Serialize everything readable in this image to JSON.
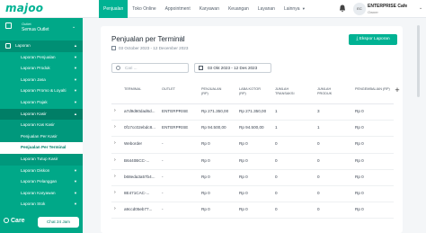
{
  "app": {
    "logo": "majoo"
  },
  "topnav": {
    "items": [
      {
        "label": "Penjualan",
        "active": true
      },
      {
        "label": "Toko Online",
        "active": false
      },
      {
        "label": "Appointment",
        "active": false
      },
      {
        "label": "Karyawan",
        "active": false
      },
      {
        "label": "Keuangan",
        "active": false
      },
      {
        "label": "Layanan",
        "active": false
      },
      {
        "label": "Lainnya",
        "active": false
      }
    ],
    "account": {
      "initials": "EC",
      "name": "ENTERPRISE Cafe",
      "role": "Owner"
    }
  },
  "sidebar": {
    "outlet_label": "Outlet",
    "outlet_value": "Semua Outlet",
    "menu": [
      {
        "label": "Laporan",
        "level": "top"
      },
      {
        "label": "Laporan Penjualan",
        "level": "sub"
      },
      {
        "label": "Laporan Produk",
        "level": "sub"
      },
      {
        "label": "Laporan Jasa",
        "level": "sub"
      },
      {
        "label": "Laporan Promo & Loyalti",
        "level": "sub"
      },
      {
        "label": "Laporan Pajak",
        "level": "sub"
      },
      {
        "label": "Laporan Kasir",
        "level": "sub",
        "selected": true
      },
      {
        "label": "Laporan Kas Kasir",
        "level": "subsub"
      },
      {
        "label": "Penjualan Per Kasir",
        "level": "subsub"
      },
      {
        "label": "Penjualan Per Terminal",
        "level": "subsub",
        "active": true
      },
      {
        "label": "Laporan Tutup Kasir",
        "level": "subsub"
      },
      {
        "label": "Laporan Diskon",
        "level": "sub"
      },
      {
        "label": "Laporan Pelanggan",
        "level": "sub"
      },
      {
        "label": "Laporan Karyawan",
        "level": "sub"
      },
      {
        "label": "Laporan Stok",
        "level": "sub"
      }
    ],
    "care_label": "Care",
    "chat_button": "Chat 24 Jam"
  },
  "page": {
    "title": "Penjualan per Terminal",
    "date_range": "03 October 2023 - 12 December 2023",
    "export_button": "Ekspor Laporan",
    "search_placeholder": "Cari ...",
    "date_picker_value": "03 Okt 2023 - 12 Des 2023"
  },
  "table": {
    "columns": [
      "Terminal",
      "Outlet",
      "Penjualan (Rp)",
      "Laba Kotor (Rp)",
      "Jumlah Transaksi",
      "Jumlah Produk",
      "Pengembalian (Rp)"
    ],
    "rows": [
      [
        "a7d9d60dad6d...",
        "ENTERPRISE",
        "Rp 271.350,00",
        "Rp 271.350,00",
        "1",
        "3",
        "Rp 0"
      ],
      [
        "0f17cc02ebdc8...",
        "ENTERPRISE",
        "Rp 94.500,00",
        "Rp 94.500,00",
        "1",
        "1",
        "Rp 0"
      ],
      [
        "Weborder",
        "-",
        "Rp 0",
        "Rp 0",
        "0",
        "0",
        "Rp 0"
      ],
      [
        "B6440BCC-...",
        "-",
        "Rp 0",
        "Rp 0",
        "0",
        "0",
        "Rp 0"
      ],
      [
        "b68eda3a57b4...",
        "-",
        "Rp 0",
        "Rp 0",
        "0",
        "0",
        "Rp 0"
      ],
      [
        "8E471CAC-...",
        "-",
        "Rp 0",
        "Rp 0",
        "0",
        "0",
        "Rp 0"
      ],
      [
        "a9ccd05eb77...",
        "-",
        "Rp 0",
        "Rp 0",
        "0",
        "0",
        "Rp 0"
      ]
    ]
  },
  "colors": {
    "brand": "#00b293",
    "sidebar": "#00a888"
  }
}
